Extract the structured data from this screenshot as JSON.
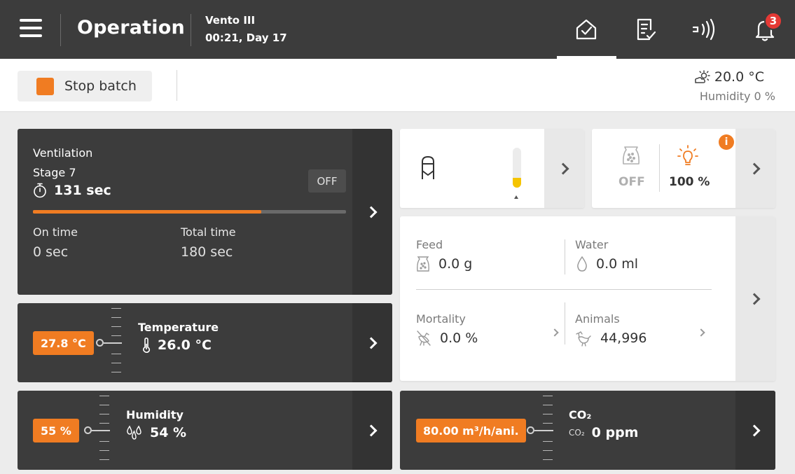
{
  "header": {
    "title": "Operation",
    "device_name": "Vento III",
    "device_time": "00:21, Day 17",
    "notification_count": "3",
    "nav_icons": [
      "house-check-icon",
      "checklist-icon",
      "broadcast-icon",
      "bell-icon"
    ]
  },
  "toolbar": {
    "stop_batch_label": "Stop batch",
    "weather_temperature": "20.0 °C",
    "weather_humidity": "Humidity 0 %"
  },
  "ventilation": {
    "title": "Ventilation",
    "stage": "Stage 7",
    "timer": "131 sec",
    "state": "OFF",
    "progress_percent": 73,
    "on_time_label": "On time",
    "on_time_value": "0 sec",
    "total_time_label": "Total time",
    "total_time_value": "180 sec"
  },
  "temperature": {
    "setpoint": "27.8 °C",
    "title": "Temperature",
    "value": "26.0 °C"
  },
  "humidity": {
    "setpoint": "55 %",
    "title": "Humidity",
    "value": "54 %"
  },
  "silo": {
    "level_fraction": 0.25
  },
  "feeder_light": {
    "feeder_state": "OFF",
    "light_level": "100 %",
    "info_label": "i"
  },
  "stats": {
    "feed_label": "Feed",
    "feed_value": "0.0 g",
    "water_label": "Water",
    "water_value": "0.0 ml",
    "mortality_label": "Mortality",
    "mortality_value": "0.0 %",
    "animals_label": "Animals",
    "animals_value": "44,996"
  },
  "co2": {
    "setpoint": "80.00 m³/h/ani.",
    "title": "CO₂",
    "icon_text": "CO₂",
    "value": "0 ppm"
  },
  "colors": {
    "header_bg": "#3c3c3c",
    "accent": "#f07c22",
    "badge": "#e53935"
  }
}
